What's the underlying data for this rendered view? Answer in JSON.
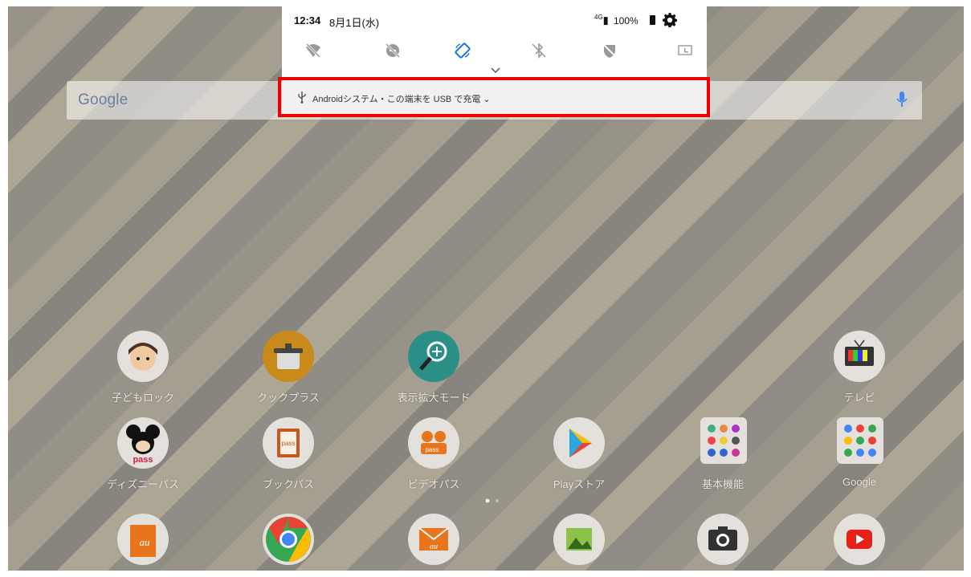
{
  "status_bar": {
    "time": "12:34",
    "date": "8月1日(水)",
    "signal": "4G",
    "battery": "100%"
  },
  "quick_settings": {
    "tiles": [
      "wifi-off-icon",
      "do-not-disturb-off-icon",
      "auto-rotate-icon",
      "bluetooth-off-icon",
      "data-saver-icon",
      "desktop-mode-icon"
    ]
  },
  "notification": {
    "text": "Androidシステム・この端末を USB で充電 ⌄"
  },
  "search_bar": {
    "logo": "Google"
  },
  "apps": {
    "row1": [
      "子どもロック",
      "クックプラス",
      "表示拡大モード",
      "テレビ"
    ],
    "row2": [
      "ディズニーパス",
      "ブックパス",
      "ビデオパス",
      "Playストア",
      "基本機能",
      "Google"
    ],
    "row3": [
      "au",
      "chrome-icon",
      "auメール",
      "gallery-icon",
      "camera-icon",
      "youtube-icon"
    ]
  },
  "colors": {
    "highlight": "#ee0000",
    "accent_blue": "#1a73e8",
    "play_green": "#3ddc84"
  }
}
